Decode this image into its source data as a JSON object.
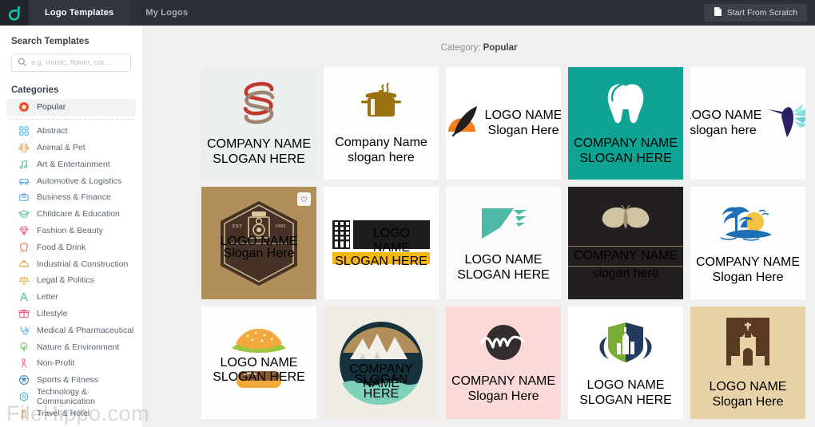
{
  "topbar": {
    "brand_icon": "dochipo-logo-icon",
    "tabs": [
      {
        "label": "Logo Templates",
        "active": true
      },
      {
        "label": "My Logos",
        "active": false
      }
    ],
    "scratch_button": {
      "label": "Start From Scratch",
      "icon": "document-icon"
    }
  },
  "sidebar": {
    "search_heading": "Search Templates",
    "search_placeholder": "e.g. music, flower, car...",
    "search_value": "",
    "search_icon": "search-icon",
    "categories_heading": "Categories",
    "items": [
      {
        "label": "Popular",
        "icon": "star-badge-icon",
        "active": true,
        "color": "#f2512b"
      },
      {
        "label": "Abstract",
        "icon": "abstract-squares-icon",
        "active": false,
        "color": "#45b4e8"
      },
      {
        "label": "Animal & Pet",
        "icon": "paw-icon",
        "active": false,
        "color": "#e8a55c"
      },
      {
        "label": "Art & Entertainment",
        "icon": "music-note-icon",
        "active": false,
        "color": "#4bc2a5"
      },
      {
        "label": "Automotive & Logistics",
        "icon": "car-icon",
        "active": false,
        "color": "#5aa8e8"
      },
      {
        "label": "Business & Finance",
        "icon": "briefcase-icon",
        "active": false,
        "color": "#5aa8e8"
      },
      {
        "label": "Childcare & Education",
        "icon": "graduation-cap-icon",
        "active": false,
        "color": "#4bbf89"
      },
      {
        "label": "Fashion & Beauty",
        "icon": "diamond-icon",
        "active": false,
        "color": "#ef5f8a"
      },
      {
        "label": "Food & Drink",
        "icon": "chef-hat-icon",
        "active": false,
        "color": "#f0784a"
      },
      {
        "label": "Industrial & Construction",
        "icon": "hard-hat-icon",
        "active": false,
        "color": "#f0a858"
      },
      {
        "label": "Legal & Politics",
        "icon": "scales-icon",
        "active": false,
        "color": "#e8b84b"
      },
      {
        "label": "Letter",
        "icon": "letter-a-icon",
        "active": false,
        "color": "#4bbf89"
      },
      {
        "label": "Lifestyle",
        "icon": "gift-icon",
        "active": false,
        "color": "#ef5f7a"
      },
      {
        "label": "Medical & Pharmaceutical",
        "icon": "stethoscope-icon",
        "active": false,
        "color": "#5aa8e8"
      },
      {
        "label": "Nature & Environment",
        "icon": "tree-icon",
        "active": false,
        "color": "#7cc45a"
      },
      {
        "label": "Non-Profit",
        "icon": "ribbon-icon",
        "active": false,
        "color": "#ef5f7a"
      },
      {
        "label": "Sports & Fitness",
        "icon": "soccer-ball-icon",
        "active": false,
        "color": "#4a90c2"
      },
      {
        "label": "Technology & Communication",
        "icon": "hexagon-tech-icon",
        "active": false,
        "color": "#45b4e8"
      },
      {
        "label": "Travel & Hotel",
        "icon": "lighthouse-icon",
        "active": false,
        "color": "#e8a55c"
      }
    ]
  },
  "main": {
    "category_prefix": "Category:",
    "category_name": "Popular",
    "templates": [
      {
        "id": "t1",
        "icon": "letter-s-monogram-icon",
        "name": "COMPANY NAME",
        "slogan": "SLOGAN HERE",
        "bg": "#ecefef",
        "name_color": "#a8897a",
        "slogan_color": "#c4c7c9",
        "favorited": false
      },
      {
        "id": "t2",
        "icon": "cooking-pot-icon",
        "name": "Company Name",
        "slogan": "slogan here",
        "bg": "#fdfdfb",
        "name_color": "#9a7310",
        "slogan_color": "#9a7310",
        "favorited": false
      },
      {
        "id": "t3",
        "icon": "feather-sunrise-icon",
        "name": "LOGO NAME",
        "slogan": "Slogan Here",
        "bg": "#ffffff",
        "name_color": "#2b2b2b",
        "slogan_color": "#444444",
        "favorited": false
      },
      {
        "id": "t4",
        "icon": "tooth-icon",
        "name": "COMPANY NAME",
        "slogan": "SLOGAN HERE",
        "bg": "#0fa393",
        "name_color": "#ffffff",
        "slogan_color": "#d6efeb",
        "favorited": false
      },
      {
        "id": "t5",
        "icon": "hummingbird-icon",
        "name": "LOGO NAME",
        "slogan": "slogan here",
        "bg": "#fdfdfd",
        "name_color": "#2b1f63",
        "slogan_color": "#4a4380",
        "favorited": false
      },
      {
        "id": "t6",
        "icon": "vintage-camera-badge-icon",
        "name": "LOGO NAME",
        "slogan": "Slogan Here",
        "bg": "#b08f5a",
        "name_color": "#e8d9b0",
        "slogan_color": "#e8d9b0",
        "favorited": true,
        "est": "EST",
        "year": "1985"
      },
      {
        "id": "t7",
        "icon": "tire-track-icon",
        "name": "LOGO NAME",
        "slogan": "SLOGAN HERE",
        "bg": "#ffffff",
        "name_color": "#ffffff",
        "slogan_color": "#ffffff",
        "favorited": false
      },
      {
        "id": "t8",
        "icon": "check-wing-icon",
        "name": "LOGO NAME",
        "slogan": "SLOGAN HERE",
        "bg": "#fbfbfb",
        "name_color": "#111111",
        "slogan_color": "#9a9a9a",
        "favorited": false
      },
      {
        "id": "t9",
        "icon": "butterfly-icon",
        "name": "COMPANY NAME",
        "slogan": "slogan here",
        "bg": "#231f20",
        "name_color": "#ddd2b4",
        "slogan_color": "#c6b893",
        "favorited": false
      },
      {
        "id": "t10",
        "icon": "palm-island-sunset-icon",
        "name": "COMPANY NAME",
        "slogan": "Slogan Here",
        "bg": "#fdfdfd",
        "name_color": "#2f6fb5",
        "slogan_color": "#5a93cc",
        "favorited": false
      },
      {
        "id": "t11",
        "icon": "burger-icon",
        "name": "LOGO NAME",
        "slogan": "SLOGAN HERE",
        "bg": "#fdfdfd",
        "name_color": "#8a3c22",
        "slogan_color": "#a85a33",
        "favorited": false
      },
      {
        "id": "t12",
        "icon": "mountain-circle-icon",
        "name": "COMPANY NAME",
        "slogan": "SLOGAN HERE",
        "bg": "#efece3",
        "name_color": "#ffffff",
        "slogan_color": "#ffffff",
        "favorited": false
      },
      {
        "id": "t13",
        "icon": "letter-m-circle-icon",
        "name": "COMPANY NAME",
        "slogan": "Slogan Here",
        "bg": "#fbd9d9",
        "name_color": "#332e2e",
        "slogan_color": "#332e2e",
        "favorited": false
      },
      {
        "id": "t14",
        "icon": "city-shield-wreath-icon",
        "name": "LOGO NAME",
        "slogan": "SLOGAN HERE",
        "bg": "#ffffff",
        "name_color": "#7aad33",
        "slogan_color": "#7aad33",
        "favorited": false
      },
      {
        "id": "t15",
        "icon": "church-icon",
        "name": "LOGO NAME",
        "slogan": "Slogan Here",
        "bg": "#e8d3a8",
        "name_color": "#6b4a2a",
        "slogan_color": "#8a6a48",
        "favorited": false
      }
    ],
    "favorite_icon": "heart-icon"
  },
  "watermark": "FileHippo.com"
}
